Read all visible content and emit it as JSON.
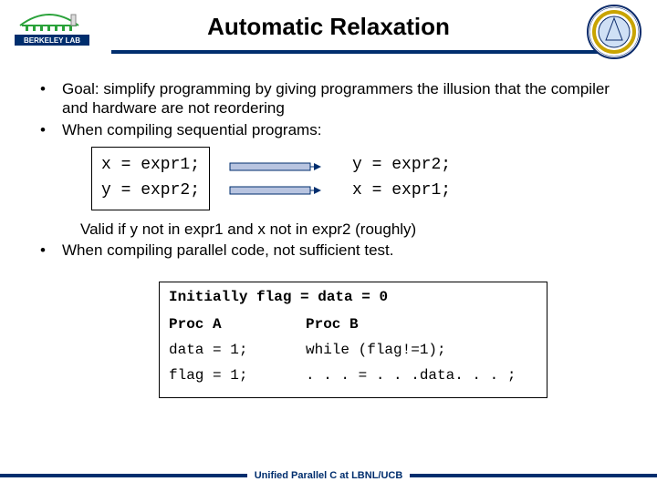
{
  "title": "Automatic Relaxation",
  "bullets": {
    "b1": "Goal: simplify programming by giving programmers the illusion that the compiler and hardware are not reordering",
    "b2": "When compiling sequential programs:"
  },
  "code_left": {
    "l1": "x = expr1;",
    "l2": "y = expr2;"
  },
  "code_right": {
    "l1": "y = expr2;",
    "l2": "x = expr1;"
  },
  "valid": "Valid if y not in expr1 and x not in expr2 (roughly)",
  "bullets2": {
    "b3": "When compiling parallel code, not sufficient test."
  },
  "table": {
    "init": "Initially flag = data = 0",
    "procA": "Proc A",
    "procB": "Proc B",
    "a1": "data = 1;",
    "b1": "while (flag!=1);",
    "a2": "flag = 1;",
    "b2": ". . . = . . .data. . . ;"
  },
  "footer": "Unified Parallel C at LBNL/UCB"
}
